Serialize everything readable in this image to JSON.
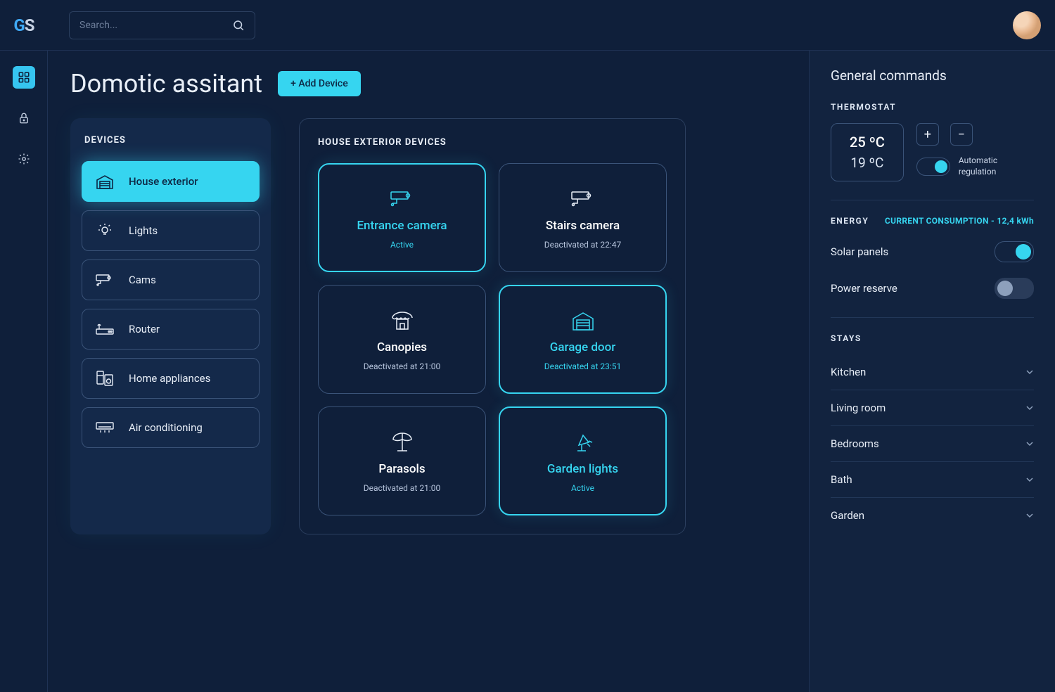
{
  "logo": {
    "g": "G",
    "s": "S"
  },
  "search": {
    "placeholder": "Search..."
  },
  "page": {
    "title": "Domotic assitant",
    "add_button": "+ Add Device"
  },
  "devices_panel": {
    "title": "DEVICES",
    "items": [
      {
        "label": "House exterior"
      },
      {
        "label": "Lights"
      },
      {
        "label": "Cams"
      },
      {
        "label": "Router"
      },
      {
        "label": "Home appliances"
      },
      {
        "label": "Air conditioning"
      }
    ]
  },
  "device_area": {
    "title": "HOUSE EXTERIOR DEVICES",
    "cards": [
      {
        "title": "Entrance camera",
        "status": "Active"
      },
      {
        "title": "Stairs camera",
        "status": "Deactivated at 22:47"
      },
      {
        "title": "Canopies",
        "status": "Deactivated at 21:00"
      },
      {
        "title": "Garage door",
        "status": "Deactivated at 23:51"
      },
      {
        "title": "Parasols",
        "status": "Deactivated at 21:00"
      },
      {
        "title": "Garden lights",
        "status": "Active"
      }
    ]
  },
  "sidebar": {
    "title": "General commands",
    "thermostat": {
      "label": "THERMOSTAT",
      "temp1": "25 ºC",
      "temp2": "19 ºC",
      "plus": "+",
      "minus": "−",
      "auto": "Automatic\nregulation"
    },
    "energy": {
      "label": "ENERGY",
      "consumption": "CURRENT CONSUMPTION - 12,4 kWh",
      "solar": "Solar panels",
      "reserve": "Power reserve"
    },
    "stays": {
      "label": "STAYS",
      "items": [
        {
          "label": "Kitchen"
        },
        {
          "label": "Living room"
        },
        {
          "label": "Bedrooms"
        },
        {
          "label": "Bath"
        },
        {
          "label": "Garden"
        }
      ]
    }
  }
}
